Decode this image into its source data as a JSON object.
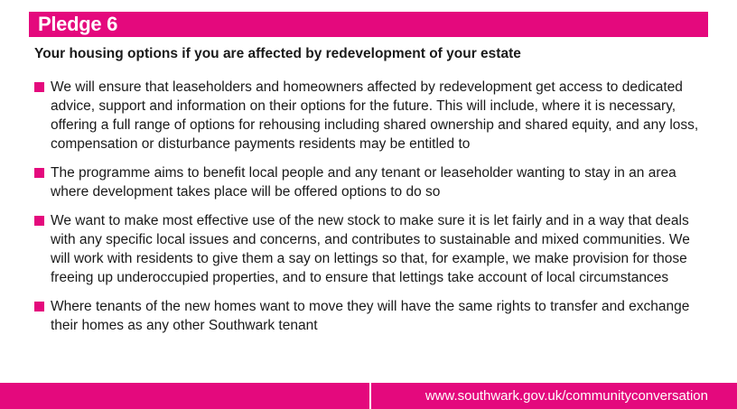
{
  "colors": {
    "accent": "#e4097d",
    "text": "#1a1a1a",
    "background": "#ffffff"
  },
  "header": {
    "title": "Pledge 6"
  },
  "subtitle": "Your housing options if you are affected by redevelopment of your estate",
  "bullets": [
    "We will ensure that leaseholders and homeowners affected by redevelopment get access to dedicated advice, support and information on their options for the future. This will include, where it is necessary, offering a full range of options for rehousing including shared ownership and shared equity, and any loss, compensation or disturbance payments residents may be entitled to",
    "The programme aims to benefit local people and any tenant or leaseholder wanting to stay in an area where development takes place will be offered options to do so",
    "We want to make most effective use of the new stock to make sure it is let fairly and in a way that deals with any specific local issues and concerns, and contributes to sustainable and mixed communities. We will work with residents to give them a say on lettings so that, for example, we make provision for those freeing up underoccupied properties, and to ensure that lettings take account of local circumstances",
    "Where tenants of the new homes want to move they will have the same rights to transfer and exchange their homes as any other Southwark tenant"
  ],
  "footer": {
    "url": "www.southwark.gov.uk/communityconversation"
  }
}
